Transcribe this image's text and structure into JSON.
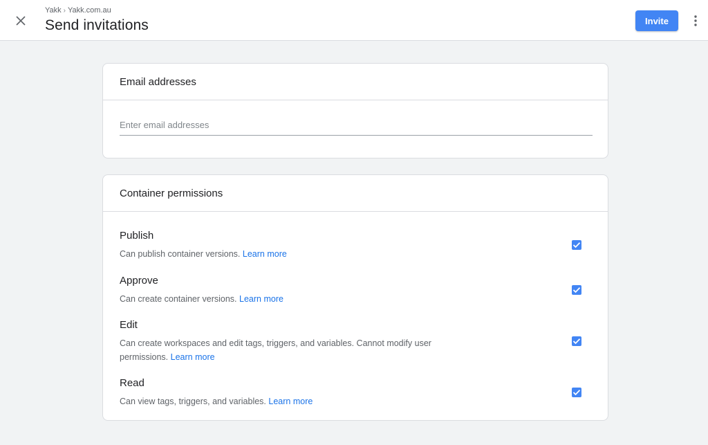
{
  "header": {
    "breadcrumb": [
      "Yakk",
      "Yakk.com.au"
    ],
    "breadcrumb_separator": "›",
    "title": "Send invitations",
    "invite_label": "Invite"
  },
  "email_section": {
    "title": "Email addresses",
    "placeholder": "Enter email addresses",
    "value": ""
  },
  "permissions_section": {
    "title": "Container permissions",
    "items": [
      {
        "name": "Publish",
        "description": "Can publish container versions.",
        "link": "Learn more",
        "checked": true
      },
      {
        "name": "Approve",
        "description": "Can create container versions.",
        "link": "Learn more",
        "checked": true
      },
      {
        "name": "Edit",
        "description": "Can create workspaces and edit tags, triggers, and variables. Cannot modify user permissions.",
        "link": "Learn more",
        "checked": true
      },
      {
        "name": "Read",
        "description": "Can view tags, triggers, and variables.",
        "link": "Learn more",
        "checked": true
      }
    ]
  },
  "colors": {
    "accent": "#4285f4",
    "link": "#1a73e8",
    "background": "#f1f3f4"
  },
  "icons": {
    "close": "close-icon",
    "more": "more-vert-icon",
    "check": "check-icon"
  }
}
